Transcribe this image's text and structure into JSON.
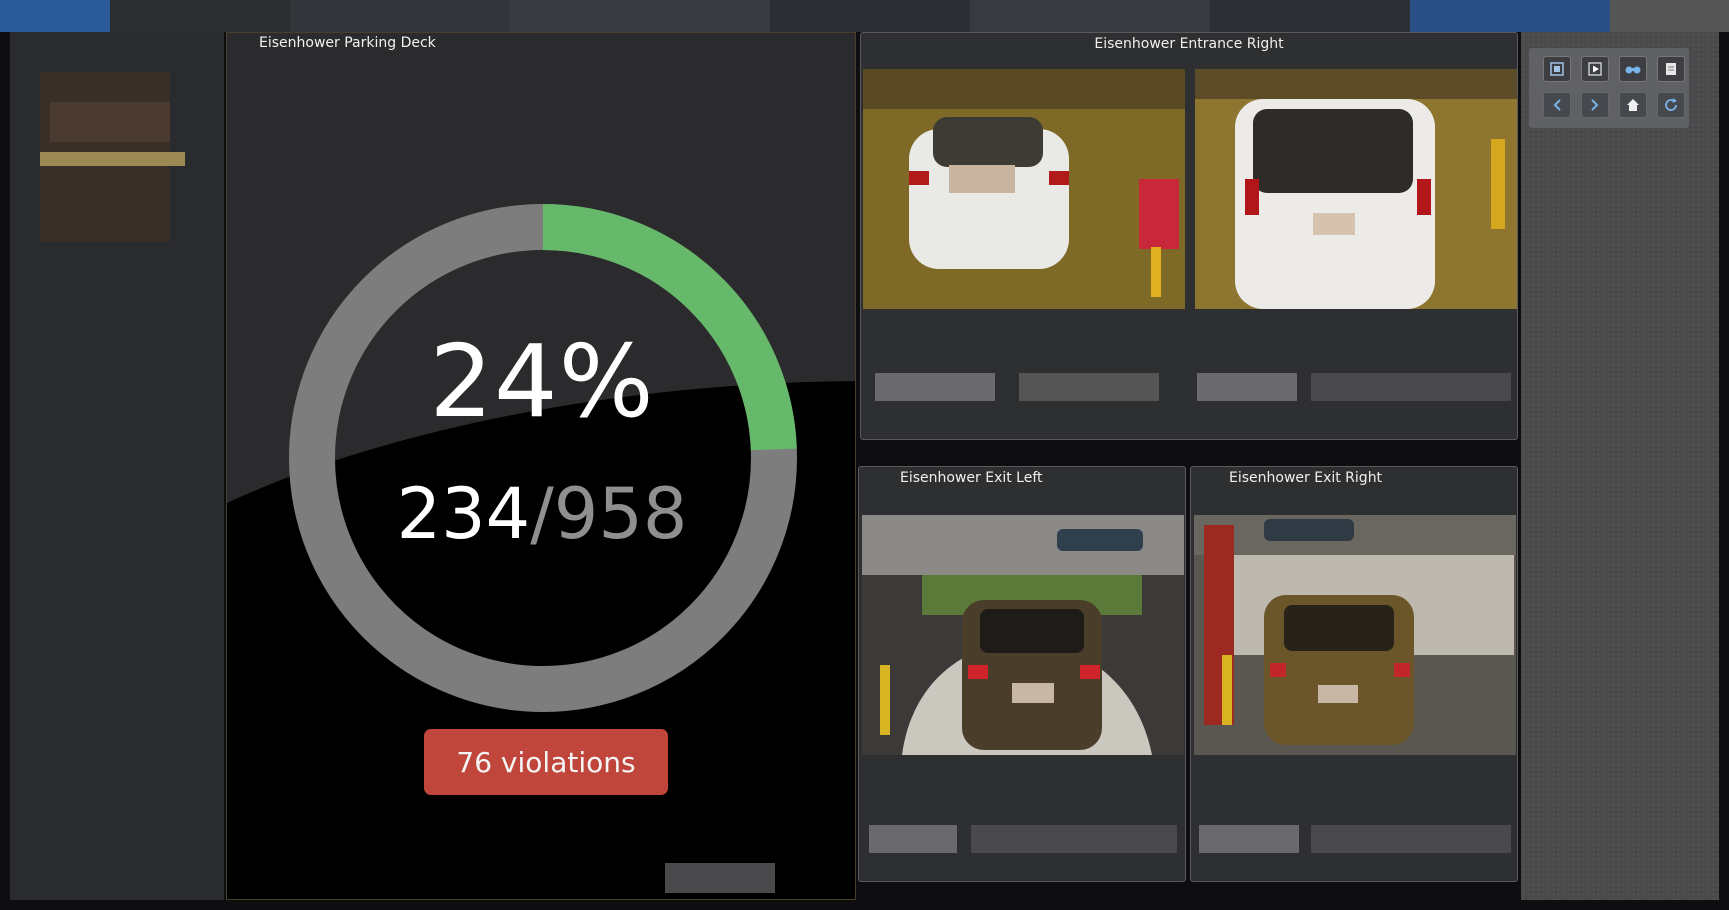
{
  "occupancy_panel": {
    "title": "Eisenhower Parking Deck",
    "percent_text": "24%",
    "occupied": "234",
    "separator": "/",
    "capacity": "958",
    "occupancy_fraction": 0.244,
    "violations_label": "76 violations"
  },
  "cameras": {
    "entrance_right": {
      "title": "Eisenhower Entrance Right"
    },
    "exit_left": {
      "title": "Eisenhower Exit Left"
    },
    "exit_right": {
      "title": "Eisenhower Exit Right"
    }
  },
  "toolbar": {
    "row1": [
      "fit-screen-icon",
      "play-icon",
      "binoculars-icon",
      "document-icon"
    ],
    "row2": [
      "chevron-left-icon",
      "chevron-right-icon",
      "home-icon",
      "refresh-icon"
    ]
  },
  "colors": {
    "gauge_fill": "#66b86a",
    "gauge_track": "#7d7d7d",
    "violations_bg": "#c0453a",
    "panel_bg": "#2b2b2d"
  }
}
